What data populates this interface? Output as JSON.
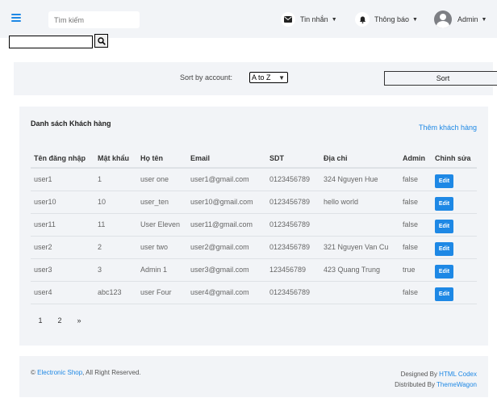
{
  "header": {
    "search_placeholder": "Tìm kiếm",
    "messages_label": "Tin nhắn",
    "notifications_label": "Thông báo",
    "user_label": "Admin"
  },
  "search2": {
    "value": ""
  },
  "sort": {
    "label": "Sort by account:",
    "selected": "A to Z",
    "button": "Sort"
  },
  "list": {
    "title": "Danh sách Khách hàng",
    "add_link": "Thêm khách hàng",
    "columns": [
      "Tên đăng nhập",
      "Mật khẩu",
      "Họ tên",
      "Email",
      "SDT",
      "Địa chỉ",
      "Admin",
      "Chỉnh sửa"
    ],
    "rows": [
      [
        "user1",
        "1",
        "user one",
        "user1@gmail.com",
        "0123456789",
        "324 Nguyen Hue",
        "false"
      ],
      [
        "user10",
        "10",
        "user_ten",
        "user10@gmail.com",
        "0123456789",
        "hello world",
        "false"
      ],
      [
        "user11",
        "11",
        "User Eleven",
        "user11@gmail.com",
        "0123456789",
        "",
        "false"
      ],
      [
        "user2",
        "2",
        "user two",
        "user2@gmail.com",
        "0123456789",
        "321 Nguyen Van Cu",
        "false"
      ],
      [
        "user3",
        "3",
        "Admin 1",
        "user3@gmail.com",
        "123456789",
        "423 Quang Trung",
        "true"
      ],
      [
        "user4",
        "abc123",
        "user Four",
        "user4@gmail.com",
        "0123456789",
        "",
        "false"
      ]
    ],
    "edit_label": "Edit",
    "pages": [
      "1",
      "2",
      "»"
    ]
  },
  "footer": {
    "copyright": "©",
    "shop_name": "Electronic Shop",
    "rights": ", All Right Reserved.",
    "designed_by": "Designed By",
    "designer": "HTML Codex",
    "distributed_by": "Distributed By",
    "distributor": "ThemeWagon"
  },
  "colors": {
    "accent": "#1e88e5",
    "panel": "#f2f4f7"
  }
}
